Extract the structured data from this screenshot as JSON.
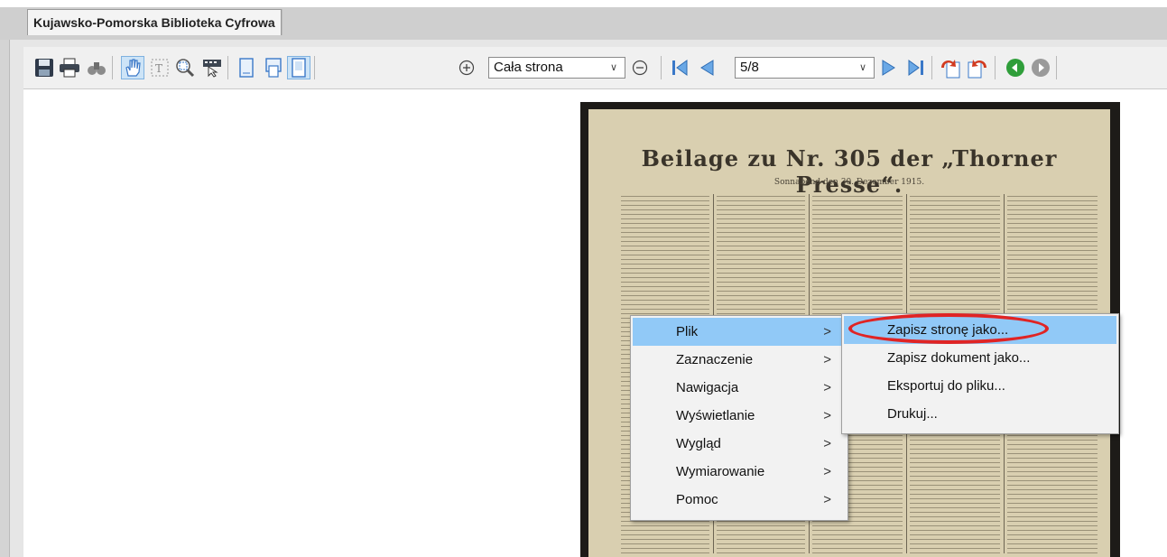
{
  "window": {
    "tab_title": "Kujawsko-Pomorska Biblioteka Cyfrowa"
  },
  "toolbar": {
    "icons": [
      "save-icon",
      "print-icon",
      "find-icon",
      "hand-tool-icon",
      "text-select-icon",
      "zoom-tool-icon",
      "area-select-icon",
      "single-page-icon",
      "continuous-page-icon",
      "facing-page-icon",
      "zoom-in-icon",
      "zoom-out-icon",
      "first-page-icon",
      "prev-page-icon",
      "next-page-icon",
      "last-page-icon",
      "rotate-left-icon",
      "rotate-right-icon",
      "back-icon",
      "forward-icon"
    ],
    "zoom_value": "Cała strona",
    "page_value": "5/8",
    "colors": {
      "blue": "#3a78c8",
      "green": "#2f9e3a",
      "red": "#d23a1f"
    }
  },
  "document": {
    "title": "Beilage zu Nr. 305 der „Thorner Presse“.",
    "subtitle": "Sonnabend den 30. Dezember 1915."
  },
  "context_menu": {
    "items": [
      {
        "label": "Plik",
        "highlighted": true
      },
      {
        "label": "Zaznaczenie"
      },
      {
        "label": "Nawigacja"
      },
      {
        "label": "Wyświetlanie"
      },
      {
        "label": "Wygląd"
      },
      {
        "label": "Wymiarowanie"
      },
      {
        "label": "Pomoc"
      }
    ],
    "submenu_arrow": ">",
    "submenu": [
      {
        "label": "Zapisz stronę jako...",
        "highlighted": true
      },
      {
        "label": "Zapisz dokument jako..."
      },
      {
        "label": "Eksportuj do pliku..."
      },
      {
        "label": "Drukuj..."
      }
    ]
  },
  "annotation_color": "#e02424"
}
